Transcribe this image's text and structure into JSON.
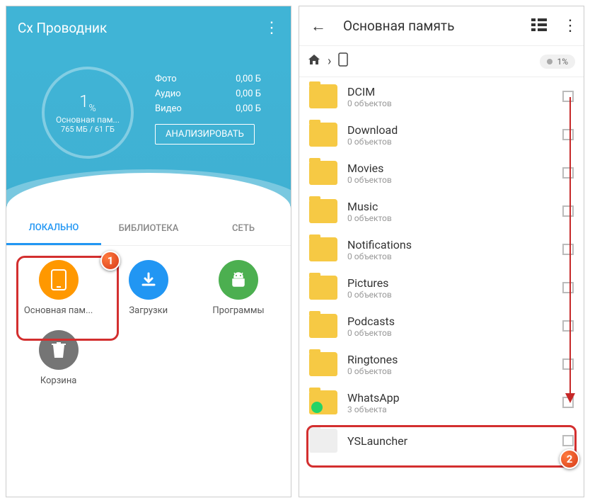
{
  "left": {
    "app_title": "Cx Проводник",
    "storage": {
      "percent": "1",
      "percent_unit": "%",
      "label": "Основная пам...",
      "size": "765 МБ / 61 ГБ"
    },
    "stats": [
      {
        "label": "Фото",
        "value": "0,00 Б"
      },
      {
        "label": "Аудио",
        "value": "0,00 Б"
      },
      {
        "label": "Видео",
        "value": "0,00 Б"
      }
    ],
    "analyze_btn": "АНАЛИЗИРОВАТЬ",
    "tabs": {
      "local": "ЛОКАЛЬНО",
      "library": "БИБЛИОТЕКА",
      "network": "СЕТЬ"
    },
    "grid": [
      {
        "label": "Основная пам...",
        "icon": "phone"
      },
      {
        "label": "Загрузки",
        "icon": "download"
      },
      {
        "label": "Программы",
        "icon": "android"
      },
      {
        "label": "Корзина",
        "icon": "trash"
      }
    ],
    "badge": "1"
  },
  "right": {
    "title": "Основная память",
    "breadcrumb_percent": "1%",
    "folders": [
      {
        "name": "DCIM",
        "sub": "0 объектов"
      },
      {
        "name": "Download",
        "sub": "0 объектов"
      },
      {
        "name": "Movies",
        "sub": "0 объектов"
      },
      {
        "name": "Music",
        "sub": "0 объектов"
      },
      {
        "name": "Notifications",
        "sub": "0 объектов"
      },
      {
        "name": "Pictures",
        "sub": "0 объектов"
      },
      {
        "name": "Podcasts",
        "sub": "0 объектов"
      },
      {
        "name": "Ringtones",
        "sub": "0 объектов"
      },
      {
        "name": "WhatsApp",
        "sub": "3 объекта",
        "wa": true
      },
      {
        "name": "YSLauncher",
        "sub": "",
        "loading": true
      }
    ],
    "badge": "2"
  }
}
